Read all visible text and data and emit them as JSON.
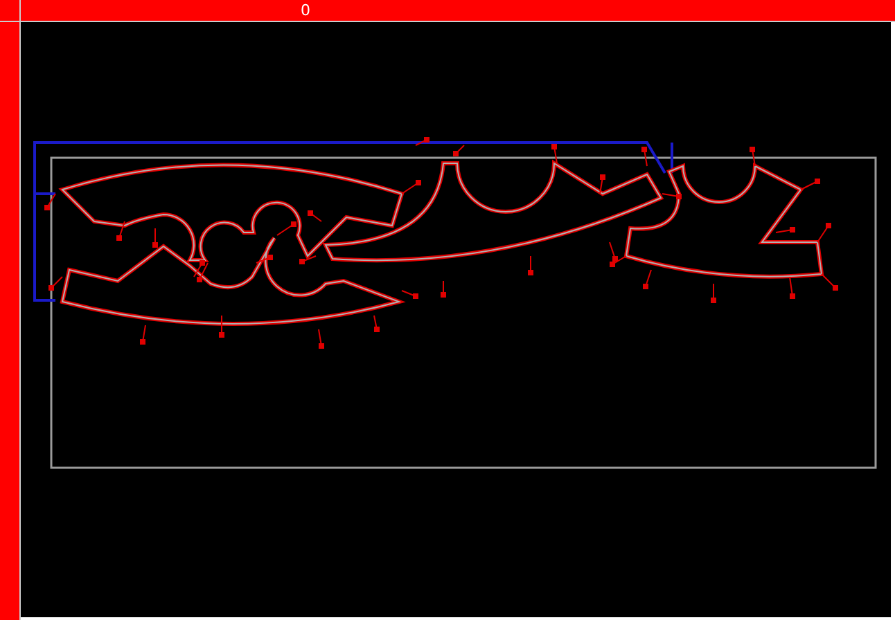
{
  "top_ruler": {
    "label": "0"
  }
}
